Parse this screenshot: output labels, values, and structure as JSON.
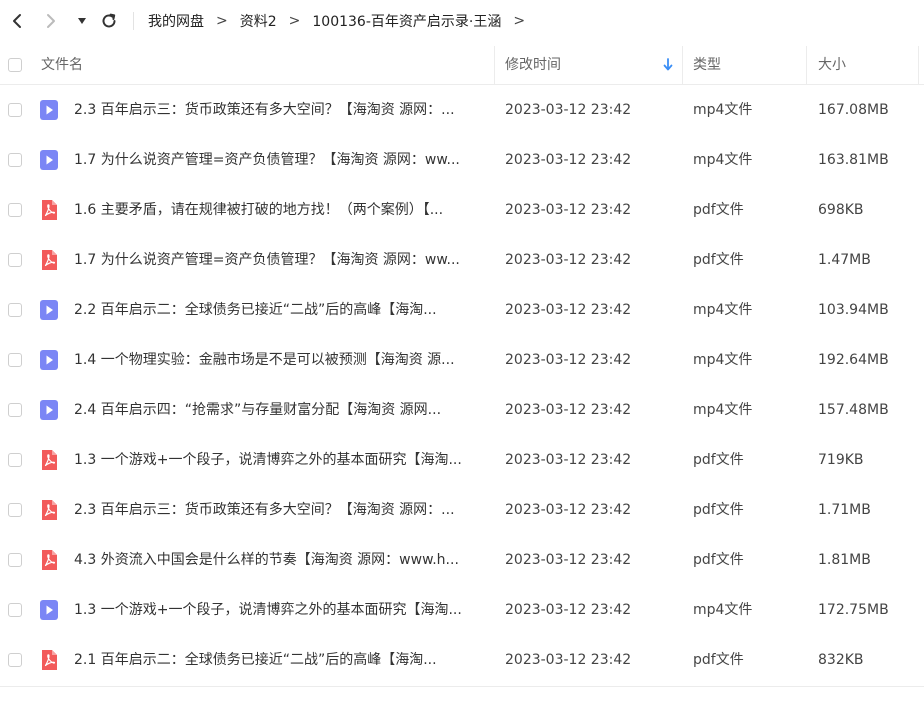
{
  "breadcrumb": {
    "items": [
      "我的网盘",
      "资料2",
      "100136-百年资产启示录·王涵"
    ],
    "separator": ">"
  },
  "header": {
    "name": "文件名",
    "modified": "修改时间",
    "type": "类型",
    "size": "大小",
    "sort_icon": "arrow-down-icon"
  },
  "colors": {
    "video_icon": "#7b86f5",
    "pdf_icon": "#f25a5a",
    "sort_arrow": "#3a8ef6"
  },
  "files": [
    {
      "icon": "video",
      "name": "2.3 百年启示三：货币政策还有多大空间？【海淘资 源网：...",
      "modified": "2023-03-12 23:42",
      "type": "mp4文件",
      "size": "167.08MB"
    },
    {
      "icon": "video",
      "name": "1.7 为什么说资产管理=资产负债管理？【海淘资 源网：ww...",
      "modified": "2023-03-12 23:42",
      "type": "mp4文件",
      "size": "163.81MB"
    },
    {
      "icon": "pdf",
      "name": "1.6 主要矛盾，请在规律被打破的地方找！（两个案例）【...",
      "modified": "2023-03-12 23:42",
      "type": "pdf文件",
      "size": "698KB"
    },
    {
      "icon": "pdf",
      "name": "1.7 为什么说资产管理=资产负债管理？【海淘资 源网：ww...",
      "modified": "2023-03-12 23:42",
      "type": "pdf文件",
      "size": "1.47MB"
    },
    {
      "icon": "video",
      "name": "2.2 百年启示二：全球债务已接近“二战”后的高峰【海淘...",
      "modified": "2023-03-12 23:42",
      "type": "mp4文件",
      "size": "103.94MB"
    },
    {
      "icon": "video",
      "name": "1.4 一个物理实验：金融市场是不是可以被预测【海淘资 源...",
      "modified": "2023-03-12 23:42",
      "type": "mp4文件",
      "size": "192.64MB"
    },
    {
      "icon": "video",
      "name": "2.4 百年启示四：“抢需求”与存量财富分配【海淘资 源网...",
      "modified": "2023-03-12 23:42",
      "type": "mp4文件",
      "size": "157.48MB"
    },
    {
      "icon": "pdf",
      "name": "1.3 一个游戏+一个段子，说清博弈之外的基本面研究【海淘...",
      "modified": "2023-03-12 23:42",
      "type": "pdf文件",
      "size": "719KB"
    },
    {
      "icon": "pdf",
      "name": "2.3 百年启示三：货币政策还有多大空间？【海淘资 源网：...",
      "modified": "2023-03-12 23:42",
      "type": "pdf文件",
      "size": "1.71MB"
    },
    {
      "icon": "pdf",
      "name": "4.3 外资流入中国会是什么样的节奏【海淘资 源网：www.h...",
      "modified": "2023-03-12 23:42",
      "type": "pdf文件",
      "size": "1.81MB"
    },
    {
      "icon": "video",
      "name": "1.3 一个游戏+一个段子，说清博弈之外的基本面研究【海淘...",
      "modified": "2023-03-12 23:42",
      "type": "mp4文件",
      "size": "172.75MB"
    },
    {
      "icon": "pdf",
      "name": "2.1 百年启示二：全球债务已接近“二战”后的高峰【海淘...",
      "modified": "2023-03-12 23:42",
      "type": "pdf文件",
      "size": "832KB"
    }
  ]
}
